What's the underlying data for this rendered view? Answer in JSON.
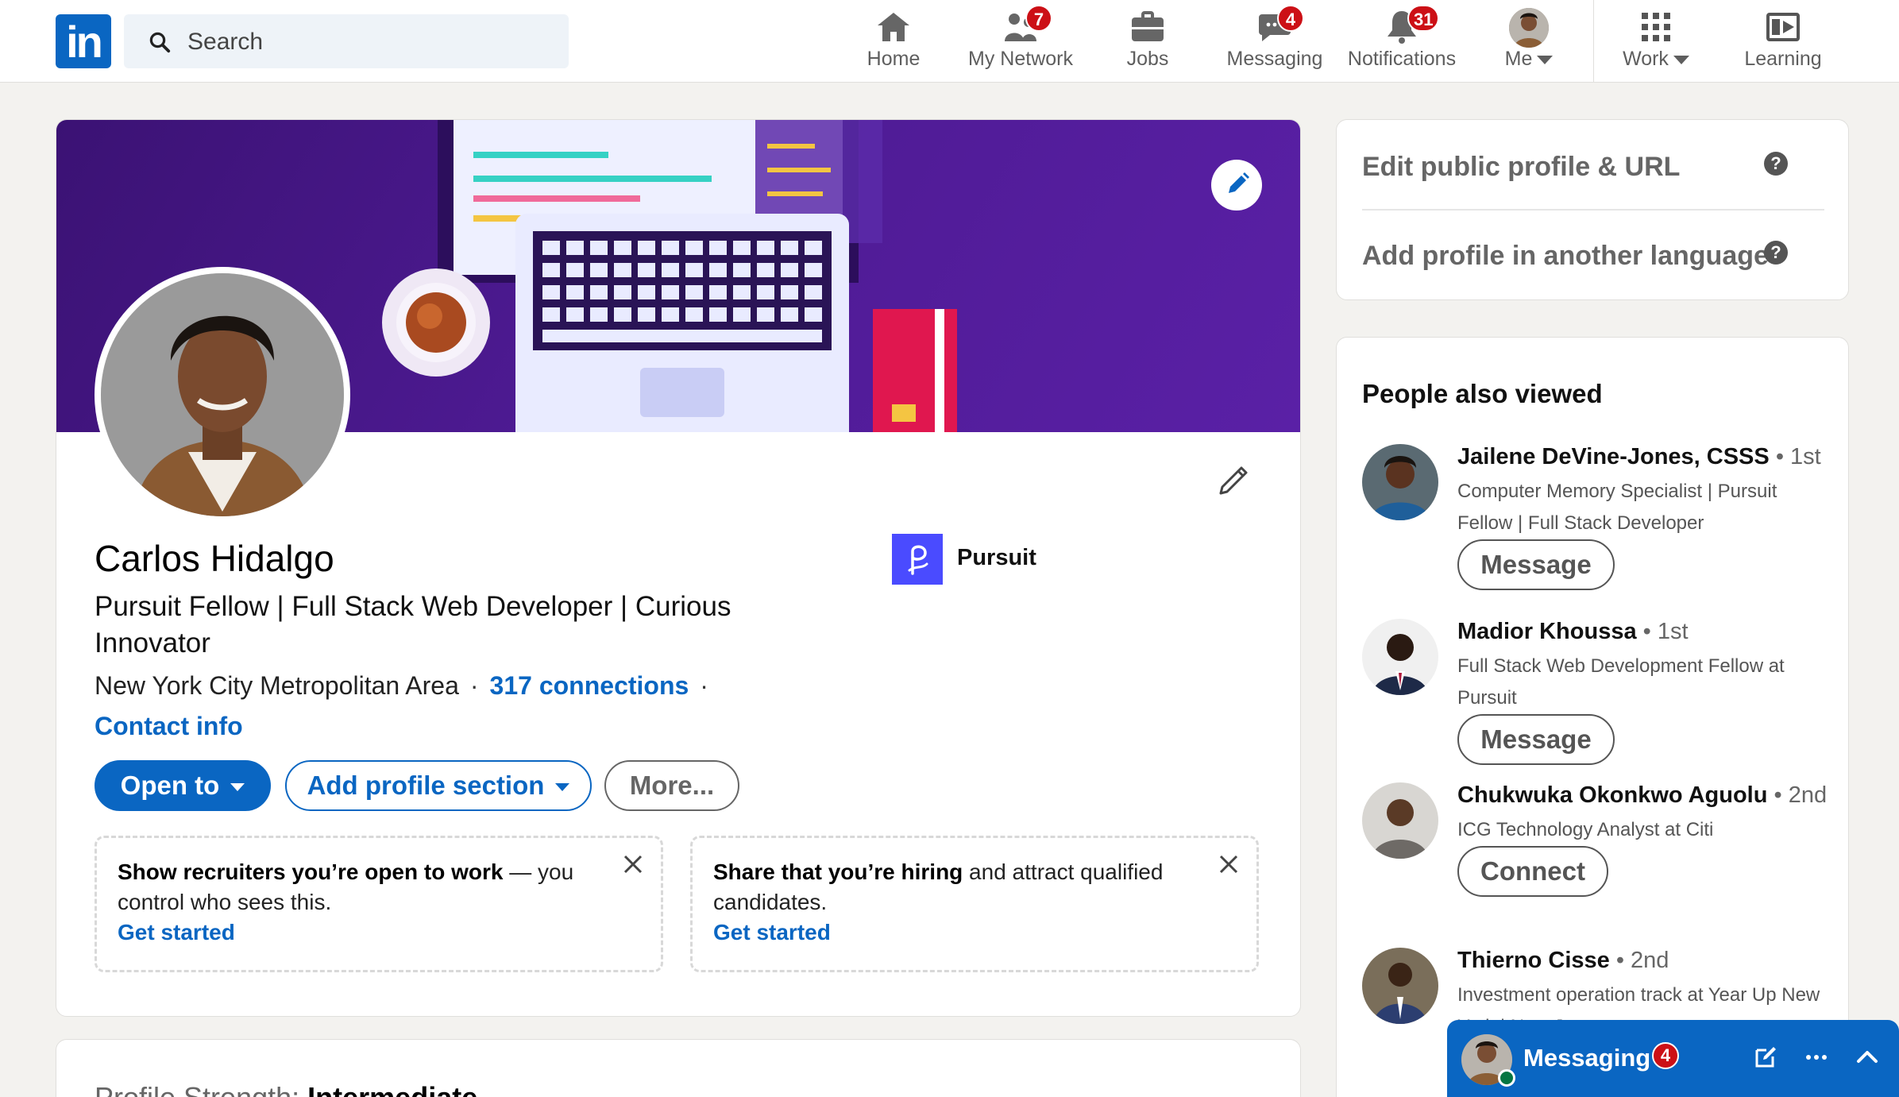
{
  "nav": {
    "search_placeholder": "Search",
    "items": [
      {
        "label": "Home",
        "icon": "home-icon"
      },
      {
        "label": "My Network",
        "icon": "network-icon",
        "badge": "7"
      },
      {
        "label": "Jobs",
        "icon": "briefcase-icon"
      },
      {
        "label": "Messaging",
        "icon": "messaging-icon",
        "badge": "4"
      },
      {
        "label": "Notifications",
        "icon": "bell-icon",
        "badge": "31"
      },
      {
        "label": "Me",
        "icon": "avatar"
      },
      {
        "label": "Work",
        "icon": "grid-icon"
      },
      {
        "label": "Learning",
        "icon": "learning-icon"
      }
    ]
  },
  "profile": {
    "name": "Carlos Hidalgo",
    "headline": "Pursuit Fellow | Full Stack Web Developer | Curious Innovator",
    "location": "New York City Metropolitan Area",
    "connections": "317 connections",
    "contact_info": "Contact info",
    "company": "Pursuit",
    "buttons": {
      "open_to": "Open to",
      "add_section": "Add profile section",
      "more": "More..."
    },
    "promos": [
      {
        "bold": "Show recruiters you’re open to work",
        "rest": " — you control who sees this.",
        "cta": "Get started"
      },
      {
        "bold": "Share that you’re hiring",
        "rest": " and attract qualified candidates.",
        "cta": "Get started"
      }
    ],
    "strength_label": "Profile Strength:",
    "strength_value": "Intermediate"
  },
  "sidebar": {
    "edit_public": "Edit public profile & URL",
    "add_language": "Add profile in another language",
    "help_glyph": "?",
    "people_title": "People also viewed",
    "people": [
      {
        "name": "Jailene DeVine-Jones, CSSS",
        "degree": "• 1st",
        "desc": "Computer Memory Specialist | Pursuit Fellow | Full Stack Developer",
        "action": "Message"
      },
      {
        "name": "Madior Khoussa",
        "degree": "• 1st",
        "desc": "Full Stack Web Development Fellow at Pursuit",
        "action": "Message"
      },
      {
        "name": "Chukwuka Okonkwo Aguolu",
        "degree": "• 2nd",
        "desc": "ICG Technology Analyst at Citi",
        "action": "Connect"
      },
      {
        "name": "Thierno Cisse",
        "degree": "• 2nd",
        "desc": "Investment operation track at Year Up New York | New Jersey",
        "action": ""
      }
    ]
  },
  "messaging": {
    "label": "Messaging",
    "badge": "4"
  },
  "colors": {
    "brand": "#0a66c2",
    "badge": "#cc1016",
    "banner": "#4d1a92",
    "background": "#f3f2ef"
  }
}
